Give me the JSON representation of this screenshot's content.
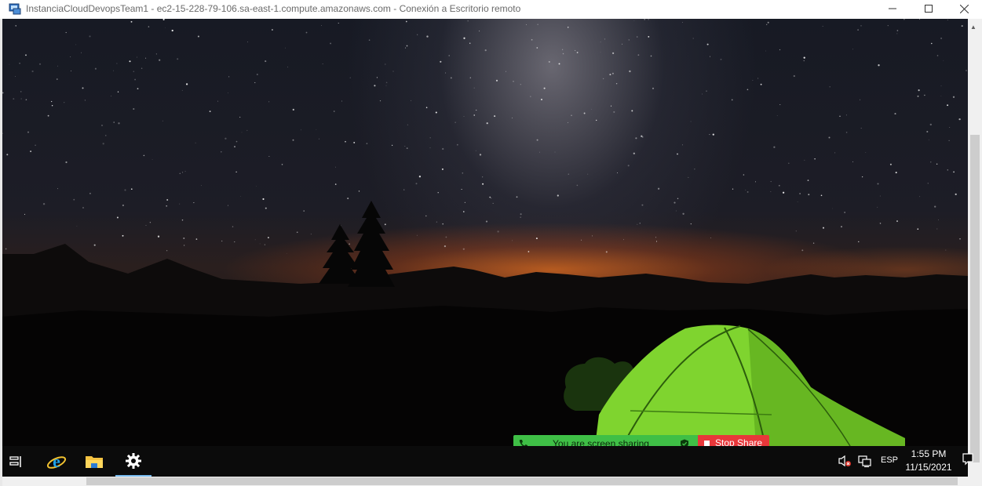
{
  "window": {
    "title": "InstanciaCloudDevopsTeam1 - ec2-15-228-79-106.sa-east-1.compute.amazonaws.com - Conexión a Escritorio remoto",
    "minimize_icon": "minimize-icon",
    "maximize_icon": "maximize-icon",
    "close_icon": "close-icon"
  },
  "screen_share": {
    "status": "You are screen sharing",
    "stop_label": "Stop Share",
    "bar_color": "#3fbf46",
    "stop_color": "#e8373a"
  },
  "taskbar": {
    "items": [
      {
        "name": "task-view",
        "icon": "task-view-icon"
      },
      {
        "name": "internet-explorer",
        "icon": "ie-icon"
      },
      {
        "name": "file-explorer",
        "icon": "folder-icon"
      },
      {
        "name": "settings",
        "icon": "gear-icon",
        "active": true
      }
    ],
    "tray": {
      "language": "ESP",
      "time": "1:55 PM",
      "date": "11/15/2021"
    }
  }
}
